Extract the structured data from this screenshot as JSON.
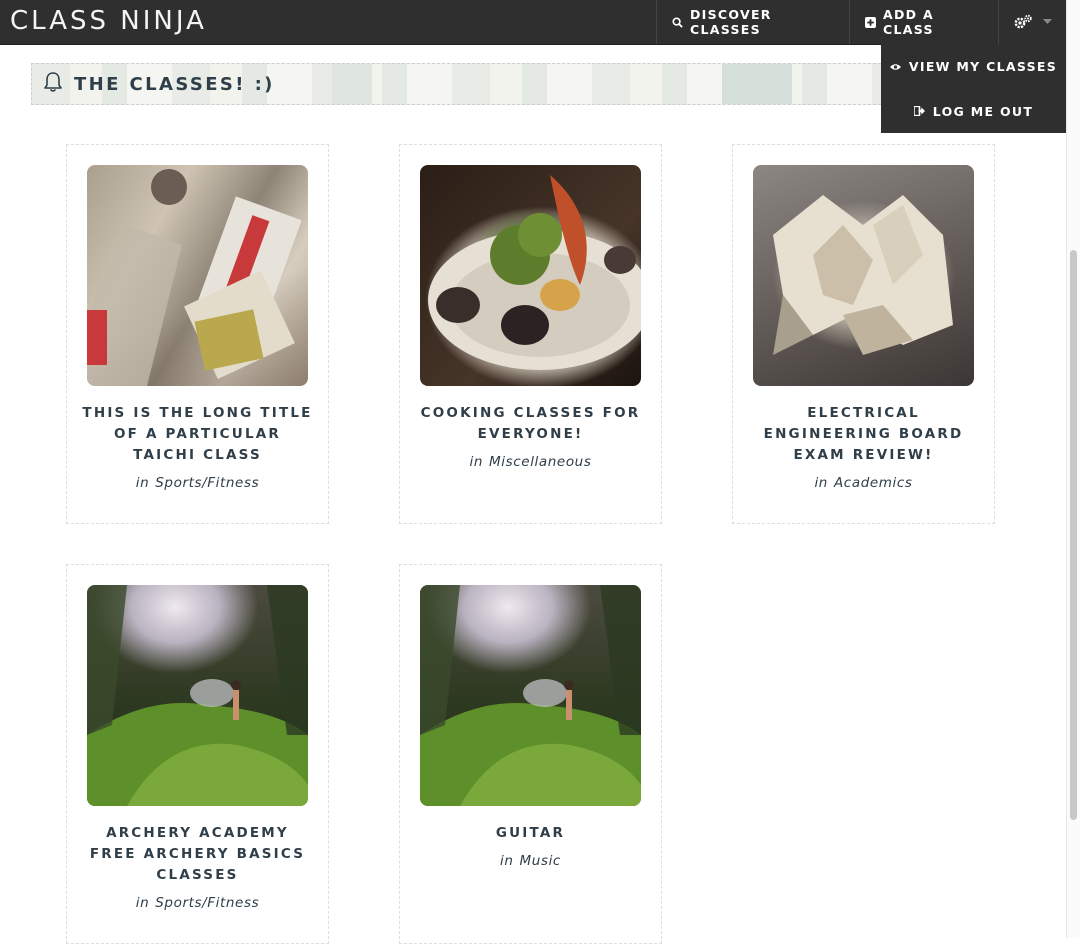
{
  "navbar": {
    "brand": "CLASS NINJA",
    "discover_label": "DISCOVER CLASSES",
    "add_label": "ADD A CLASS"
  },
  "dropdown": {
    "view_label": "VIEW MY CLASSES",
    "logout_label": "LOG ME OUT"
  },
  "section": {
    "title": "THE CLASSES! :)"
  },
  "cards": [
    {
      "title_lines": [
        "THIS IS THE LONG TITLE",
        "OF A PARTICULAR",
        "TAICHI CLASS"
      ],
      "in": "in",
      "category": "Sports/Fitness",
      "image": "art-sketches"
    },
    {
      "title_lines": [
        "COOKING CLASSES FOR",
        "EVERYONE!"
      ],
      "in": "in",
      "category": "Miscellaneous",
      "image": "plated-food"
    },
    {
      "title_lines": [
        "ELECTRICAL",
        "ENGINEERING BOARD",
        "EXAM REVIEW!"
      ],
      "in": "in",
      "category": "Academics",
      "image": "paper-sculpture"
    },
    {
      "title_lines": [
        "ARCHERY ACADEMY",
        "FREE ARCHERY BASICS",
        "CLASSES"
      ],
      "in": "in",
      "category": "Sports/Fitness",
      "image": "forest-waterfall"
    },
    {
      "title_lines": [
        "GUITAR"
      ],
      "in": "in",
      "category": "Music",
      "image": "forest-waterfall"
    }
  ],
  "colors": {
    "navbar_bg": "#2f2f2f",
    "text": "#2f3e48",
    "white": "#ffffff"
  },
  "icons": {
    "discover": "search-icon",
    "add": "plus-square-icon",
    "settings": "gears-icon",
    "caret": "caret-down-icon",
    "view": "eye-icon",
    "logout": "sign-out-icon",
    "section": "bell-icon"
  }
}
